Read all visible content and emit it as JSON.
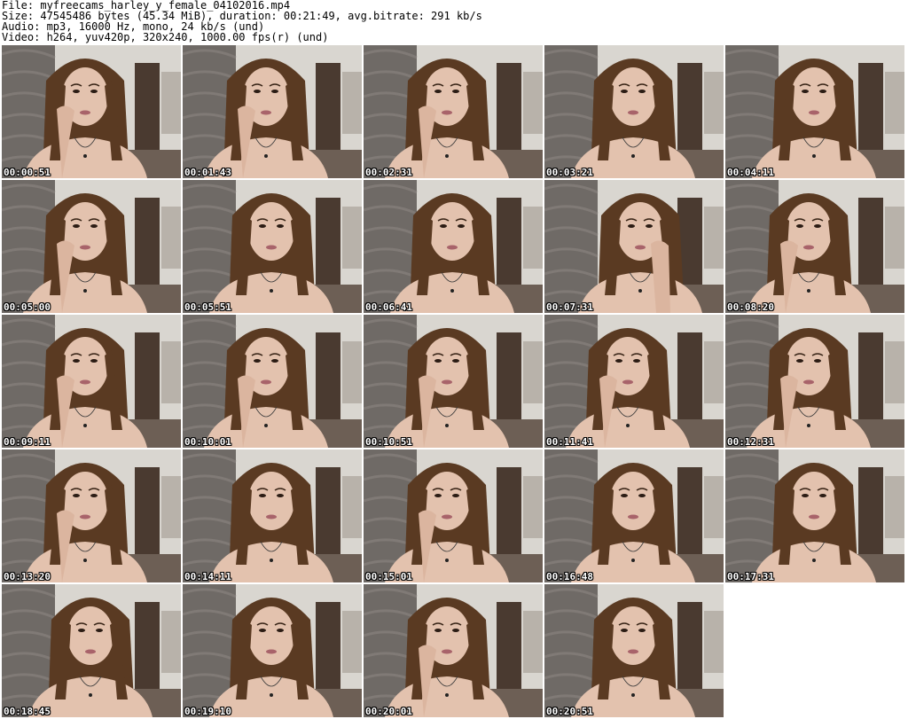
{
  "header": {
    "file": "File: myfreecams_harley_y_female_04102016.mp4",
    "size": "Size: 47545486 bytes (45.34 MiB), duration: 00:21:49, avg.bitrate: 291 kb/s",
    "audio": "Audio: mp3, 16000 Hz, mono, 24 kb/s (und)",
    "video": "Video: h264, yuv420p, 320x240, 1000.00 fps(r) (und)"
  },
  "thumbnails": [
    {
      "timestamp": "00:00:51",
      "pose": "hand-left"
    },
    {
      "timestamp": "00:01:43",
      "pose": "hand-left"
    },
    {
      "timestamp": "00:02:31",
      "pose": "hand-left"
    },
    {
      "timestamp": "00:03:21",
      "pose": "front"
    },
    {
      "timestamp": "00:04:11",
      "pose": "front"
    },
    {
      "timestamp": "00:05:00",
      "pose": "hand-left"
    },
    {
      "timestamp": "00:05:51",
      "pose": "front"
    },
    {
      "timestamp": "00:06:41",
      "pose": "front"
    },
    {
      "timestamp": "00:07:31",
      "pose": "hand-right"
    },
    {
      "timestamp": "00:08:20",
      "pose": "hand-left"
    },
    {
      "timestamp": "00:09:11",
      "pose": "hand-left"
    },
    {
      "timestamp": "00:10:01",
      "pose": "hand-left"
    },
    {
      "timestamp": "00:10:51",
      "pose": "hand-left"
    },
    {
      "timestamp": "00:11:41",
      "pose": "hand-left"
    },
    {
      "timestamp": "00:12:31",
      "pose": "hand-left"
    },
    {
      "timestamp": "00:13:20",
      "pose": "hand-left"
    },
    {
      "timestamp": "00:14:11",
      "pose": "front"
    },
    {
      "timestamp": "00:15:01",
      "pose": "hand-left"
    },
    {
      "timestamp": "00:16:48",
      "pose": "front"
    },
    {
      "timestamp": "00:17:31",
      "pose": "front"
    },
    {
      "timestamp": "00:18:45",
      "pose": "front"
    },
    {
      "timestamp": "00:19:10",
      "pose": "front"
    },
    {
      "timestamp": "00:20:01",
      "pose": "hand-left"
    },
    {
      "timestamp": "00:20:51",
      "pose": "front"
    }
  ],
  "colors": {
    "background": "#ffffff",
    "header_text": "#000000",
    "timestamp_text": "#ffffff",
    "timestamp_outline": "#000000",
    "wall_left": "#6f6a66",
    "room_right": "#d9d6d0",
    "door": "#4a3a30",
    "hair": "#5a3a22",
    "skin": "#e3c2ae"
  }
}
